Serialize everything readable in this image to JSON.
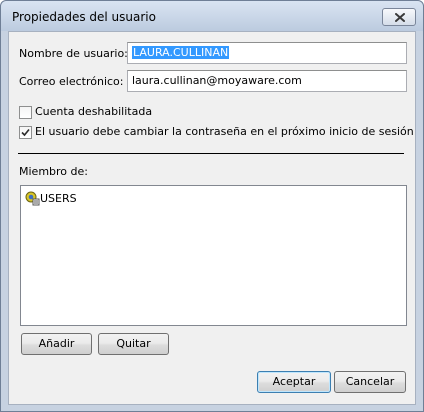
{
  "window": {
    "title": "Propiedades del usuario"
  },
  "form": {
    "username_label": "Nombre de usuario:",
    "username_value": "LAURA.CULLINAN",
    "email_label": "Correo electrónico:",
    "email_value": "laura.cullinan@moyaware.com"
  },
  "options": {
    "account_disabled_label": "Cuenta deshabilitada",
    "account_disabled_checked": false,
    "must_change_password_label": "El usuario debe cambiar la contraseña en el próximo inicio de sesión",
    "must_change_password_checked": true
  },
  "membership": {
    "label": "Miembro de:",
    "groups": [
      "USERS"
    ],
    "group_icon": "user-group-icon"
  },
  "buttons": {
    "add": "Añadir",
    "remove": "Quitar",
    "accept": "Aceptar",
    "cancel": "Cancelar"
  },
  "colors": {
    "selection": "#3399ff",
    "title_bar": "#c7d2e1",
    "dialog_bg": "#f0f0f0"
  }
}
